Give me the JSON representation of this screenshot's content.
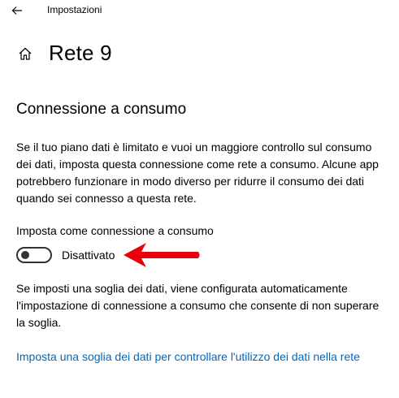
{
  "window": {
    "title": "Impostazioni",
    "back_icon": "arrow-left-icon"
  },
  "header": {
    "home_icon": "home-icon",
    "title": "Rete 9"
  },
  "metered": {
    "section_title": "Connessione a consumo",
    "description": "Se il tuo piano dati è limitato e vuoi un maggiore controllo sul consumo dei dati, imposta questa connessione come rete a consumo. Alcune app potrebbero funzionare in modo diverso per ridurre il consumo dei dati quando sei connesso a questa rete.",
    "toggle_label": "Imposta come connessione a consumo",
    "toggle_state": "Disattivato",
    "toggle_on": false,
    "note": "Se imposti una soglia dei dati, viene configurata automaticamente l'impostazione di connessione a consumo che consente di non superare la soglia.",
    "link": "Imposta una soglia dei dati per controllare l'utilizzo dei dati nella rete"
  },
  "colors": {
    "link": "#0067c0",
    "annotation_arrow": "#e8000b",
    "toggle_off": "#333333"
  }
}
